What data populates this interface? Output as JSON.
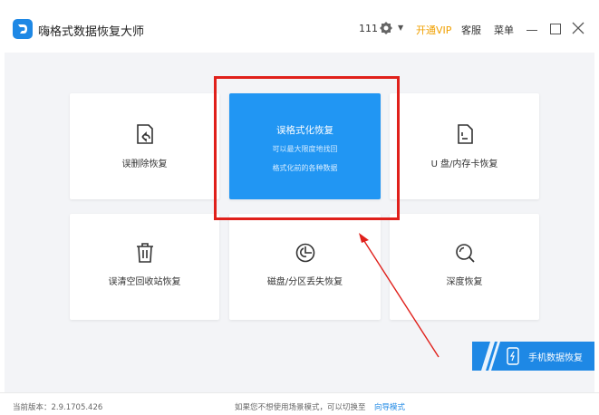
{
  "app": {
    "title": "嗨格式数据恢复大师"
  },
  "header": {
    "user_count": "111",
    "vip_label": "开通VIP",
    "service_label": "客服",
    "menu_label": "菜单"
  },
  "cards": [
    {
      "key": "deleted",
      "label": "误删除恢复",
      "icon": "file-restore-icon"
    },
    {
      "key": "format",
      "label": "误格式化恢复",
      "sub1": "可以最大限度地找回",
      "sub2": "格式化前的各种数据",
      "active": true
    },
    {
      "key": "usb",
      "label": "U 盘/内存卡恢复",
      "icon": "sd-card-icon"
    },
    {
      "key": "recycle",
      "label": "误清空回收站恢复",
      "icon": "trash-icon"
    },
    {
      "key": "partition",
      "label": "磁盘/分区丢失恢复",
      "icon": "disk-pie-icon"
    },
    {
      "key": "deep",
      "label": "深度恢复",
      "icon": "magnifier-icon"
    }
  ],
  "mobile_button": {
    "label": "手机数据恢复",
    "icon": "phone-icon"
  },
  "statusbar": {
    "version": "当前版本：2.9.1705.426",
    "switch_text": "如果您不想使用场景模式，可以切换至",
    "switch_link": "向导模式"
  },
  "colors": {
    "accent": "#2196f3",
    "vip": "#f0a000",
    "annotation": "#e0201b"
  }
}
